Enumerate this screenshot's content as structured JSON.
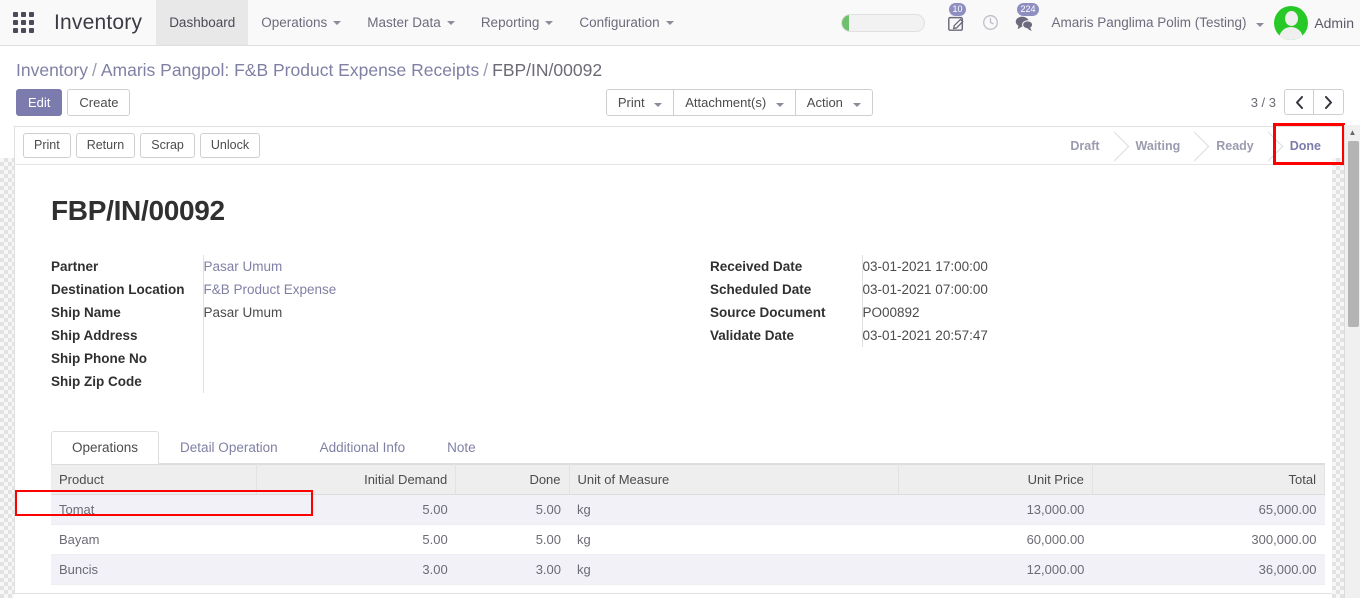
{
  "navbar": {
    "apps_icon": "apps-grid-icon",
    "brand": "Inventory",
    "menu": [
      {
        "label": "Dashboard",
        "has_caret": false,
        "active": true
      },
      {
        "label": "Operations",
        "has_caret": true,
        "active": false
      },
      {
        "label": "Master Data",
        "has_caret": true,
        "active": false
      },
      {
        "label": "Reporting",
        "has_caret": true,
        "active": false
      },
      {
        "label": "Configuration",
        "has_caret": true,
        "active": false
      }
    ],
    "progress_percent": 8,
    "icons": [
      {
        "name": "edit-note-icon",
        "badge": "10"
      },
      {
        "name": "clock-icon",
        "badge": ""
      },
      {
        "name": "chat-bubble-icon",
        "badge": "224"
      }
    ],
    "company": "Amaris Panglima Polim (Testing)",
    "user": "Admin",
    "accent_color": "#7c7bad",
    "badge_color": "#8e8ec1",
    "avatar_color": "#26c926"
  },
  "breadcrumb": {
    "root": "Inventory",
    "parent": "Amaris Pangpol: F&B Product Expense Receipts",
    "current": "FBP/IN/00092",
    "separator": "/"
  },
  "control_panel": {
    "edit_label": "Edit",
    "create_label": "Create",
    "print_label": "Print",
    "attachments_label": "Attachment(s)",
    "action_label": "Action",
    "pager_count": "3 / 3",
    "prev_icon": "chevron-left-icon",
    "next_icon": "chevron-right-icon"
  },
  "sheet_buttons": [
    {
      "label": "Print"
    },
    {
      "label": "Return"
    },
    {
      "label": "Scrap"
    },
    {
      "label": "Unlock"
    }
  ],
  "status_steps": [
    {
      "label": "Draft",
      "active": false
    },
    {
      "label": "Waiting",
      "active": false
    },
    {
      "label": "Ready",
      "active": false
    },
    {
      "label": "Done",
      "active": true,
      "highlighted": true
    }
  ],
  "highlight_color": "#ff0000",
  "record": {
    "title": "FBP/IN/00092",
    "left_fields": [
      {
        "label": "Partner",
        "value": "Pasar Umum",
        "is_link": true
      },
      {
        "label": "Destination Location",
        "value": "F&B Product Expense",
        "is_link": true
      },
      {
        "label": "Ship Name",
        "value": "Pasar Umum",
        "is_link": false
      },
      {
        "label": "Ship Address",
        "value": "",
        "is_link": false
      },
      {
        "label": "Ship Phone No",
        "value": "",
        "is_link": false
      },
      {
        "label": "Ship Zip Code",
        "value": "",
        "is_link": false
      }
    ],
    "right_fields": [
      {
        "label": "Received Date",
        "value": "03-01-2021 17:00:00",
        "highlighted": false
      },
      {
        "label": "Scheduled Date",
        "value": "03-01-2021 07:00:00",
        "highlighted": false
      },
      {
        "label": "Source Document",
        "value": "PO00892",
        "highlighted": false
      },
      {
        "label": "Validate Date",
        "value": "03-01-2021 20:57:47",
        "highlighted": true
      }
    ]
  },
  "tabs": [
    {
      "label": "Operations",
      "active": true
    },
    {
      "label": "Detail Operation",
      "active": false
    },
    {
      "label": "Additional Info",
      "active": false
    },
    {
      "label": "Note",
      "active": false
    }
  ],
  "table": {
    "columns": [
      {
        "label": "Product",
        "align": "left"
      },
      {
        "label": "Initial Demand",
        "align": "right"
      },
      {
        "label": "Done",
        "align": "right"
      },
      {
        "label": "Unit of Measure",
        "align": "left"
      },
      {
        "label": "Unit Price",
        "align": "right"
      },
      {
        "label": "Total",
        "align": "right"
      }
    ],
    "rows": [
      {
        "product": "Tomat",
        "initial_demand": "5.00",
        "done": "5.00",
        "uom": "kg",
        "unit_price": "13,000.00",
        "total": "65,000.00"
      },
      {
        "product": "Bayam",
        "initial_demand": "5.00",
        "done": "5.00",
        "uom": "kg",
        "unit_price": "60,000.00",
        "total": "300,000.00"
      },
      {
        "product": "Buncis",
        "initial_demand": "3.00",
        "done": "3.00",
        "uom": "kg",
        "unit_price": "12,000.00",
        "total": "36,000.00"
      }
    ]
  },
  "scrollbar": {
    "up_arrow": "▲"
  }
}
